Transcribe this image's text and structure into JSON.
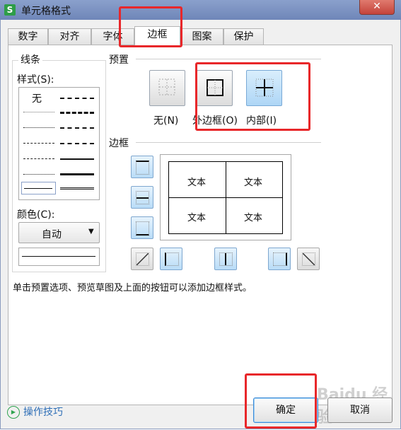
{
  "window": {
    "title": "单元格格式",
    "app_icon_glyph": "S",
    "close_glyph": "✕"
  },
  "tabs": [
    {
      "label": "数字"
    },
    {
      "label": "对齐"
    },
    {
      "label": "字体"
    },
    {
      "label": "边框",
      "active": true
    },
    {
      "label": "图案"
    },
    {
      "label": "保护"
    }
  ],
  "line": {
    "group_label": "线条",
    "style_label": "样式(S):",
    "none_label": "无",
    "color_label": "颜色(C):",
    "color_value": "自动"
  },
  "presets": {
    "group_label": "预置",
    "none_label": "无(N)",
    "outline_label": "外边框(O)",
    "inside_label": "内部(I)"
  },
  "border": {
    "group_label": "边框",
    "cell_text": [
      "文本",
      "文本",
      "文本",
      "文本"
    ]
  },
  "hint": "单击预置选项、预览草图及上面的按钮可以添加边框样式。",
  "footer": {
    "tips_label": "操作技巧",
    "ok_label": "确定",
    "cancel_label": "取消"
  },
  "watermark": "Baidu 经验",
  "colors": {
    "highlight": "#e8272a",
    "accent": "#3d8ad6",
    "title_bar": "#7a90c0"
  }
}
